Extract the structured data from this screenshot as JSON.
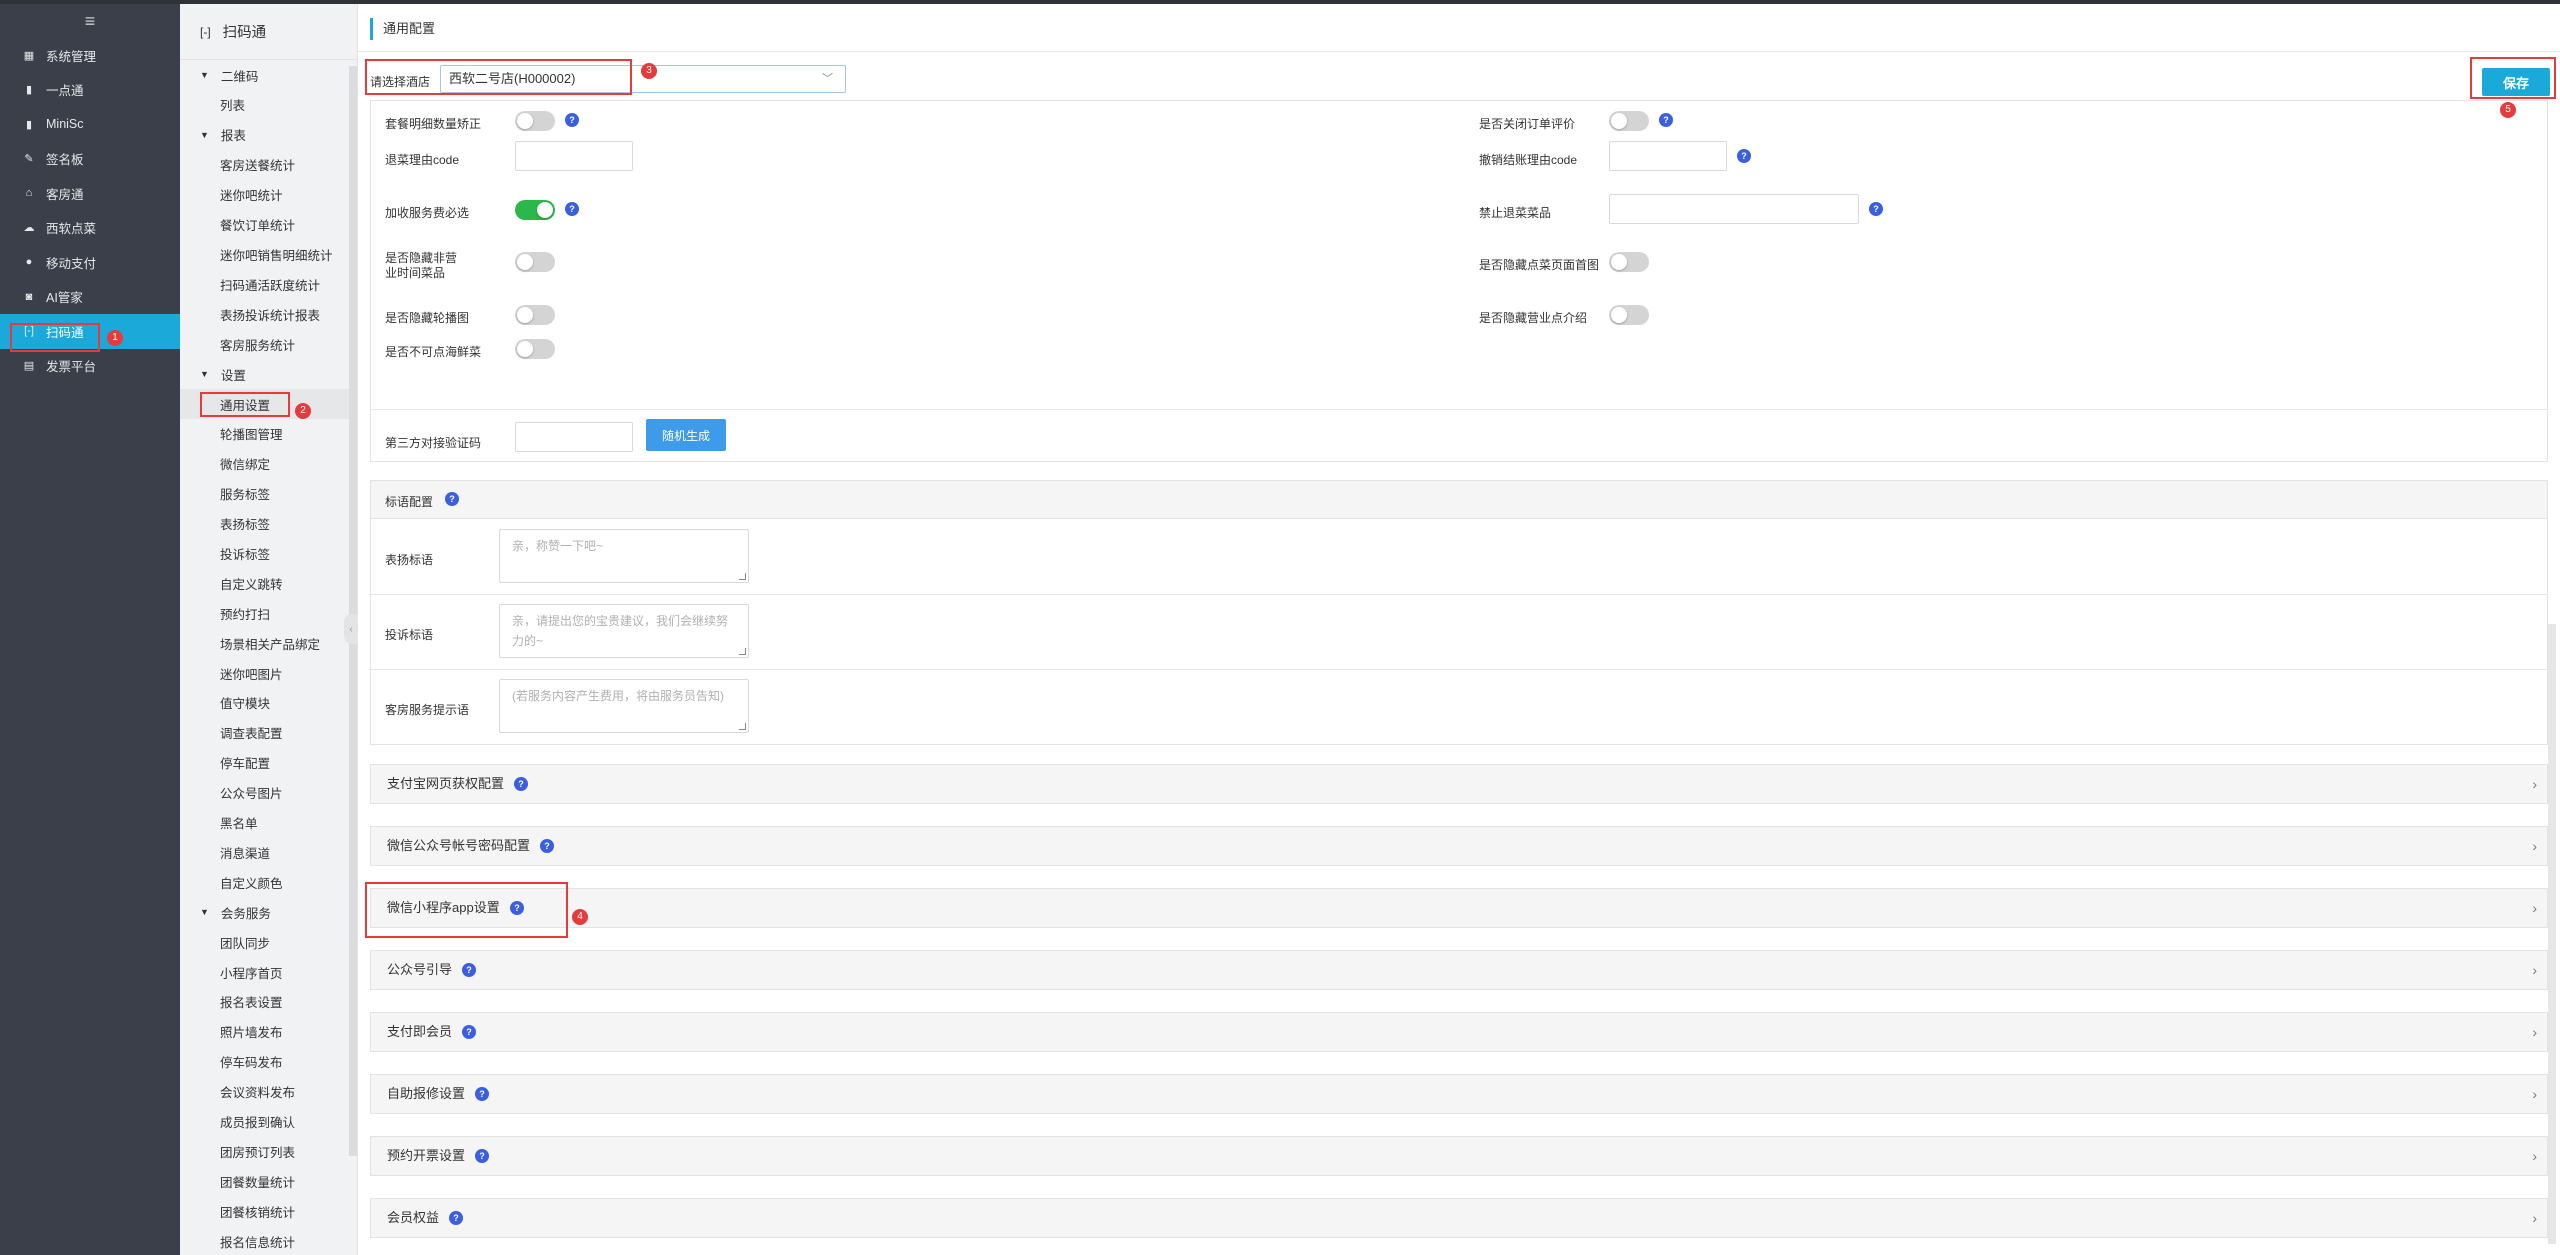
{
  "nav_primary": {
    "items": [
      {
        "label": "系统管理",
        "icon": "grid-icon"
      },
      {
        "label": "一点通",
        "icon": "chart-icon"
      },
      {
        "label": "MiniSc",
        "icon": "chart-icon"
      },
      {
        "label": "签名板",
        "icon": "pen-icon"
      },
      {
        "label": "客房通",
        "icon": "home-icon"
      },
      {
        "label": "西软点菜",
        "icon": "cloud-icon"
      },
      {
        "label": "移动支付",
        "icon": "info-icon"
      },
      {
        "label": "AI管家",
        "icon": "robot-icon"
      },
      {
        "label": "扫码通",
        "icon": "scan-icon"
      },
      {
        "label": "发票平台",
        "icon": "invoice-icon"
      }
    ],
    "active_index": 8
  },
  "nav_secondary": {
    "title": "扫码通",
    "groups": [
      {
        "label": "二维码",
        "items": [
          "列表"
        ]
      },
      {
        "label": "报表",
        "items": [
          "客房送餐统计",
          "迷你吧统计",
          "餐饮订单统计",
          "迷你吧销售明细统计",
          "扫码通活跃度统计",
          "表扬投诉统计报表",
          "客房服务统计"
        ]
      },
      {
        "label": "设置",
        "items": [
          "通用设置",
          "轮播图管理",
          "微信绑定",
          "服务标签",
          "表扬标签",
          "投诉标签",
          "自定义跳转",
          "预约打扫",
          "场景相关产品绑定",
          "迷你吧图片",
          "值守模块",
          "调查表配置",
          "停车配置",
          "公众号图片",
          "黑名单",
          "消息渠道",
          "自定义颜色"
        ]
      },
      {
        "label": "会务服务",
        "items": [
          "团队同步",
          "小程序首页",
          "报名表设置",
          "照片墙发布",
          "停车码发布",
          "会议资料发布",
          "成员报到确认",
          "团房预订列表",
          "团餐数量统计",
          "团餐核销统计",
          "报名信息统计"
        ]
      }
    ],
    "selected_item": "通用设置"
  },
  "page": {
    "title": "通用配置",
    "hotel_label": "请选择酒店",
    "hotel_value": "西软二号店(H000002)",
    "save_label": "保存"
  },
  "settings": {
    "left": [
      {
        "label": "套餐明细数量矫正",
        "type": "toggle",
        "on": false,
        "help": true
      },
      {
        "label": "退菜理由code",
        "type": "input",
        "value": "",
        "help": false
      },
      {
        "label": "加收服务费必选",
        "type": "toggle",
        "on": true,
        "help": true
      },
      {
        "label": "是否隐藏非营业时间菜品",
        "type": "toggle",
        "on": false,
        "help": false
      },
      {
        "label": "是否隐藏轮播图",
        "type": "toggle",
        "on": false,
        "help": false
      },
      {
        "label": "是否不可点海鲜菜",
        "type": "toggle",
        "on": false,
        "help": false
      }
    ],
    "right": [
      {
        "label": "是否关闭订单评价",
        "type": "toggle",
        "on": false,
        "help": true
      },
      {
        "label": "撤销结账理由code",
        "type": "input",
        "value": "",
        "help": true
      },
      {
        "label": "禁止退菜菜品",
        "type": "input",
        "value": "",
        "help": true
      },
      {
        "label": "是否隐藏点菜页面首图",
        "type": "toggle",
        "on": false,
        "help": false
      },
      {
        "label": "是否隐藏营业点介绍",
        "type": "toggle",
        "on": false,
        "help": false
      }
    ],
    "verify_label": "第三方对接验证码",
    "verify_value": "",
    "random_button": "随机生成"
  },
  "tips": {
    "header": "标语配置",
    "rows": [
      {
        "label": "表扬标语",
        "placeholder": "亲，称赞一下吧~"
      },
      {
        "label": "投诉标语",
        "placeholder": "亲，请提出您的宝贵建议，我们会继续努力的~"
      },
      {
        "label": "客房服务提示语",
        "placeholder": "(若服务内容产生费用，将由服务员告知)"
      }
    ]
  },
  "accordions": [
    "支付宝网页获权配置",
    "微信公众号帐号密码配置",
    "微信小程序app设置",
    "公众号引导",
    "支付即会员",
    "自助报修设置",
    "预约开票设置",
    "会员权益"
  ],
  "annotations": [
    "1",
    "2",
    "3",
    "4",
    "5"
  ],
  "colors": {
    "accent": "#1aa9d8",
    "nav_bg": "#3a3f49",
    "toggle_on": "#2bb84a",
    "help": "#3b5fe0",
    "marker": "#e43c3c"
  }
}
